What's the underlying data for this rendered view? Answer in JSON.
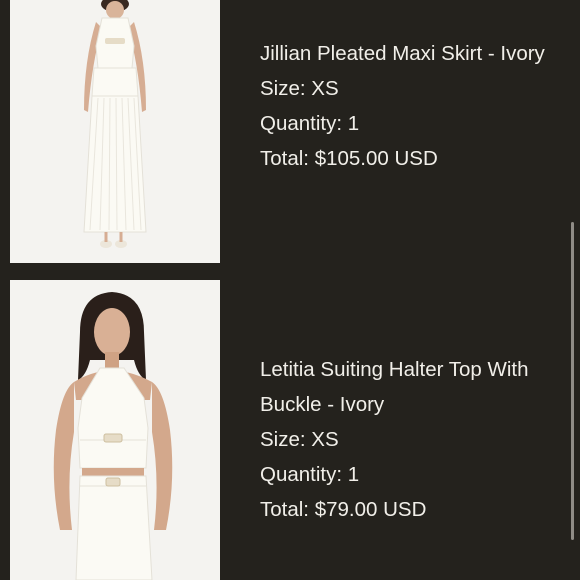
{
  "cart_items": [
    {
      "title_lines": [
        "Jillian Pleated Maxi Skirt - Ivory"
      ],
      "size": "Size: XS",
      "quantity": "Quantity: 1",
      "total": "Total: $105.00 USD",
      "image_icon": "product-photo-maxi-skirt"
    },
    {
      "title_lines": [
        "Letitia Suiting Halter Top With",
        "Buckle - Ivory"
      ],
      "size": "Size: XS",
      "quantity": "Quantity: 1",
      "total": "Total: $79.00 USD",
      "image_icon": "product-photo-halter-top"
    }
  ],
  "colors": {
    "background": "#24221d",
    "text": "#f1efe9",
    "photo_background": "#f4f3f0",
    "garment": "#fbfaf4"
  }
}
